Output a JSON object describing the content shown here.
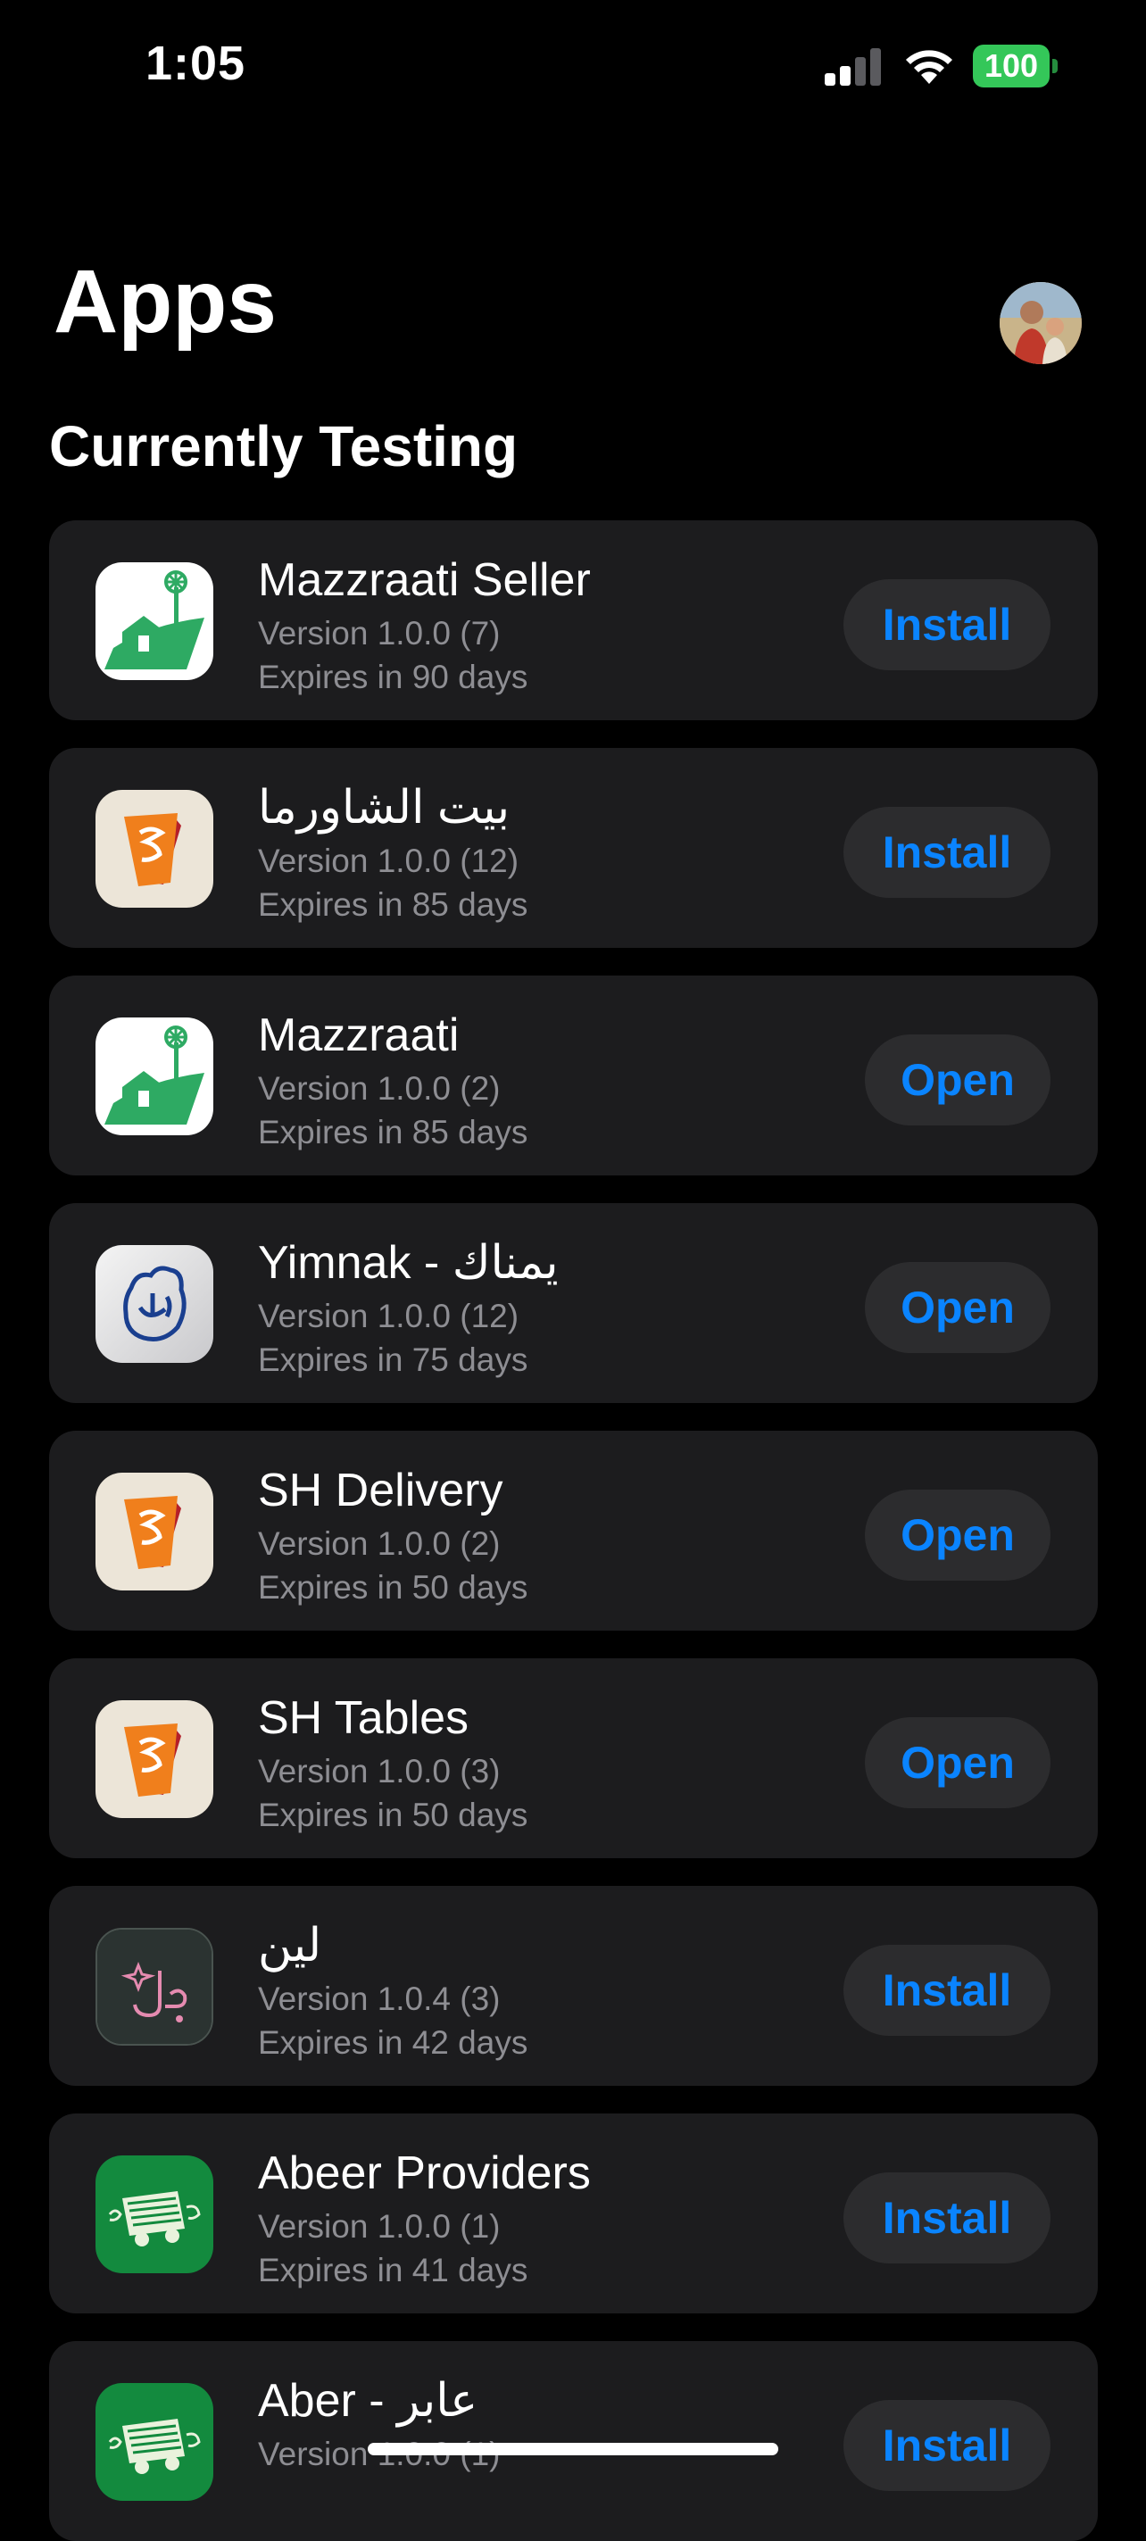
{
  "status_bar": {
    "time": "1:05",
    "battery": "100",
    "icons": [
      "cellular-signal-icon",
      "wifi-icon",
      "battery-icon"
    ]
  },
  "header": {
    "title": "Apps",
    "avatar": "profile-avatar"
  },
  "section": {
    "title": "Currently Testing"
  },
  "apps": [
    {
      "name": "Mazzraati Seller",
      "version": "Version 1.0.0 (7)",
      "expires": "Expires in 90 days",
      "action": "Install",
      "icon": "mazzraati-farm-icon"
    },
    {
      "name": "بيت الشاورما",
      "version": "Version 1.0.0 (12)",
      "expires": "Expires in 85 days",
      "action": "Install",
      "icon": "shawarma-house-icon"
    },
    {
      "name": "Mazzraati",
      "version": "Version 1.0.0 (2)",
      "expires": "Expires in 85 days",
      "action": "Open",
      "icon": "mazzraati-farm-icon"
    },
    {
      "name": "Yimnak - يمناك",
      "version": "Version 1.0.0 (12)",
      "expires": "Expires in 75 days",
      "action": "Open",
      "icon": "yimnak-logo-icon"
    },
    {
      "name": "SH Delivery",
      "version": "Version 1.0.0 (2)",
      "expires": "Expires in 50 days",
      "action": "Open",
      "icon": "shawarma-house-icon"
    },
    {
      "name": "SH Tables",
      "version": "Version 1.0.0 (3)",
      "expires": "Expires in 50 days",
      "action": "Open",
      "icon": "shawarma-house-icon"
    },
    {
      "name": "لين",
      "version": "Version 1.0.4 (3)",
      "expires": "Expires in 42 days",
      "action": "Install",
      "icon": "leen-logo-icon"
    },
    {
      "name": "Abeer Providers",
      "version": "Version 1.0.0 (1)",
      "expires": "Expires in 41 days",
      "action": "Install",
      "icon": "abeer-truck-icon"
    },
    {
      "name": "Aber - عابر",
      "version": "Version 1.0.0 (1)",
      "expires": "",
      "action": "Install",
      "icon": "abeer-truck-icon"
    }
  ],
  "colors": {
    "background": "#000000",
    "card": "#1c1c1e",
    "button_bg": "#2c2c2e",
    "accent": "#0a84ff",
    "secondary_text": "#8e8e93",
    "battery": "#34c759"
  }
}
